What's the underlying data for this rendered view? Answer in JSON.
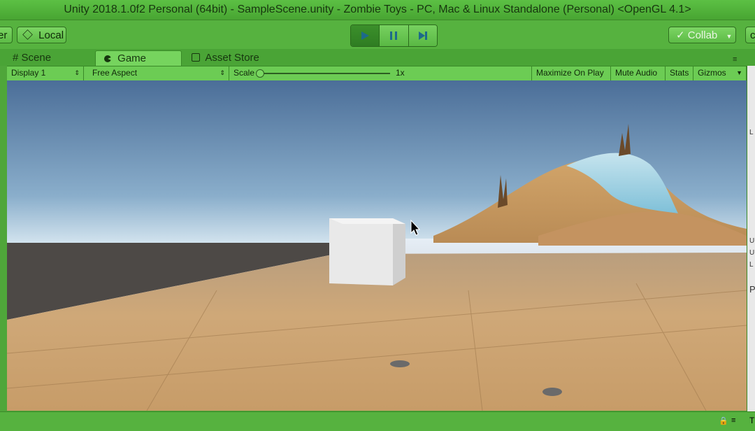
{
  "window": {
    "title": "Unity 2018.1.0f2 Personal (64bit) - SampleScene.unity - Zombie Toys - PC, Mac & Linux Standalone (Personal) <OpenGL 4.1>"
  },
  "toolbar": {
    "left_partial_label": "er",
    "local_label": "Local",
    "collab_label": "Collab",
    "right_partial_label": "c",
    "play_state": "playing"
  },
  "tabs": [
    {
      "label": "Scene",
      "icon": "hash-icon",
      "active": false
    },
    {
      "label": "Game",
      "icon": "pacman-icon",
      "active": true
    },
    {
      "label": "Asset Store",
      "icon": "store-icon",
      "active": false
    }
  ],
  "game_bar": {
    "display": "Display 1",
    "aspect": "Free Aspect",
    "scale_label": "Scale",
    "scale_value": "1x",
    "scale_fraction": 0.0,
    "maximize": "Maximize On Play",
    "mute": "Mute Audio",
    "stats": "Stats",
    "gizmos": "Gizmos"
  },
  "right_panel": {
    "lines": [
      "L",
      "U",
      "U",
      "L",
      "P"
    ]
  },
  "status": {
    "right_partial": "T"
  },
  "colors": {
    "editor_tint": "#4fa63a",
    "active_tab": "#76d45e",
    "sky_top": "#4a6c96",
    "floor": "#c8a070"
  }
}
